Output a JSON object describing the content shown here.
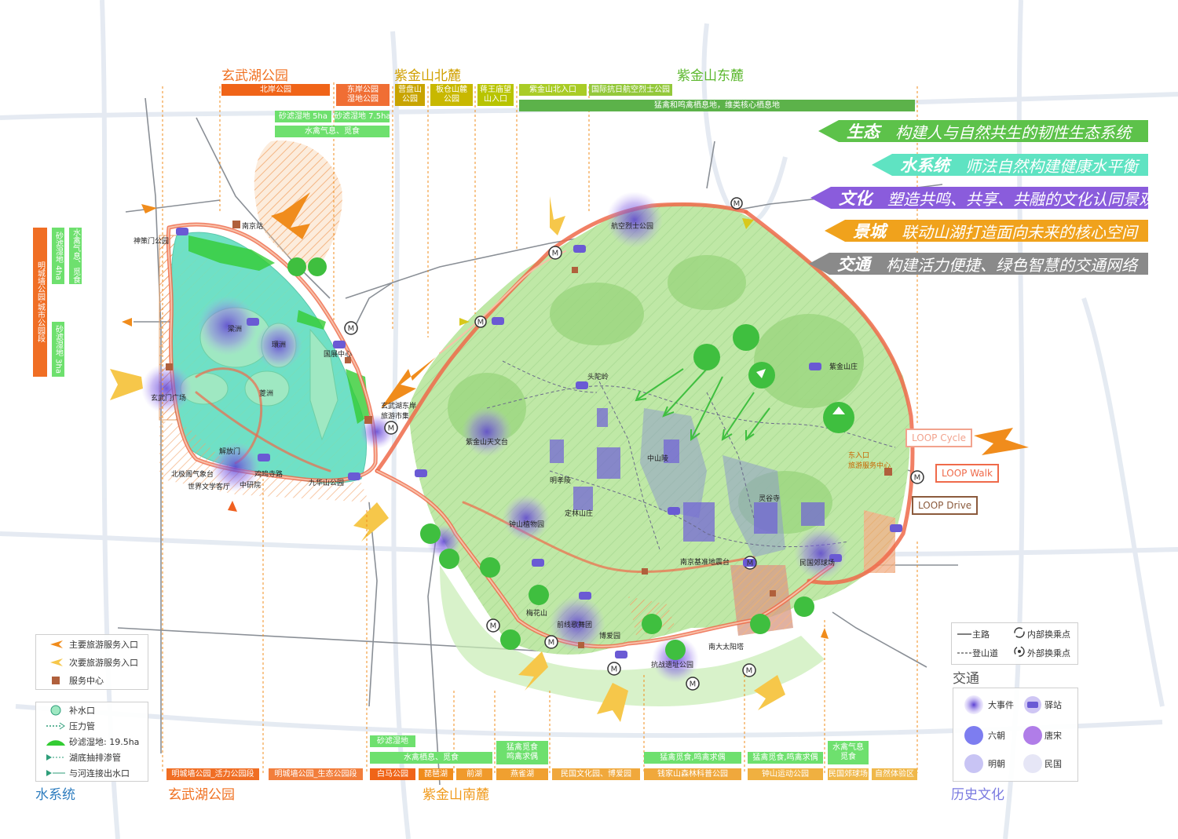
{
  "top_sections": {
    "xuanwu": "玄武湖公园",
    "zijin_north": "紫金山北麓",
    "zijin_east": "紫金山东麓",
    "bars": [
      "北岸公园",
      "东岸公园\n湿地公园",
      "营盘山\n公园",
      "板仓山麓\n公园",
      "蒋王庙望\n山入口",
      "紫金山北入口",
      "国际抗日航空烈士公园",
      "猛禽和鸣禽栖息地，维类核心栖息地"
    ],
    "sub_bars": [
      "砂滤湿地 5ha",
      "砂滤湿地 7.5ha",
      "水禽气息、觅食"
    ]
  },
  "goals": [
    {
      "key": "生态",
      "text": "构建人与自然共生的韧性生态系统",
      "color": "#5dc24a"
    },
    {
      "key": "水系统",
      "text": "师法自然构建健康水平衡",
      "color": "#5fe3c2"
    },
    {
      "key": "文化",
      "text": "塑造共鸣、共享、共融的文化认同景观",
      "color": "#8a5cdc"
    },
    {
      "key": "景城",
      "text": "联动山湖打造面向未来的核心空间",
      "color": "#f0a21c"
    },
    {
      "key": "交通",
      "text": "构建活力便捷、绿色智慧的交通网络",
      "color": "#8a8a8a"
    }
  ],
  "left_bars": [
    "明城墙公园·城市公园段",
    "砂滤湿地 4ha",
    "水禽气息、觅食",
    "砂滤湿地 3ha"
  ],
  "bottom_sections": {
    "xuanwu": "玄武湖公园",
    "zijin_south": "紫金山南麓",
    "bars": [
      "明城墙公园_活力公园段",
      "明城墙公园_生态公园段",
      "白马公园",
      "琵琶湖",
      "前湖",
      "燕雀湖",
      "民国文化园、博爱园",
      "钱家山森林科普公园",
      "钟山运动公园",
      "民国郊球场",
      "自然体验区"
    ],
    "upper_bars": [
      "砂滤湿地",
      "水禽栖息、觅食",
      "猛禽觅食\n鸣禽求偶",
      "猛禽觅食,鸣禽求偶",
      "猛禽觅食,鸣禽求偶",
      "水禽气息\n觅食"
    ]
  },
  "place_labels": {
    "nanjing_station": "南京站",
    "shence_gate": "神策门公园",
    "liangzhou": "梁洲",
    "huanzhou": "環洲",
    "yingzhou": "菱洲",
    "xuanwu_square": "玄武门广场",
    "jiefang_gate": "解放门",
    "jiming_temple": "鸡鸣寺路",
    "beiji_ge": "北极阁气象台",
    "world_lit": "世界文学客厅",
    "zhongyan": "中研院",
    "jiuhuashan": "九华山公园",
    "guoyu": "国展中心",
    "east_bank_market": "玄武湖东岸\n旅游市集",
    "hangkong": "航空烈士公园",
    "toutuo": "头陀岭",
    "observatory": "紫金山天文台",
    "mingxiao": "明孝陵",
    "zhongshan_mausoleum": "中山陵",
    "linggu": "灵谷寺",
    "dinglin": "定林山庄",
    "zhongshan_botanic": "钟山植物园",
    "meihua": "梅花山",
    "qianxian": "前线歌舞团",
    "bo_ai": "博爱园",
    "kangzhan": "抗战遗址公园",
    "nanjing_benchmark": "南京基准地震台",
    "taiyuan": "南大太阳塔",
    "minguo_golf": "民国郊球场",
    "zijin_villa": "紫金山庄",
    "east_entrance": "东入口\n旅游服务中心"
  },
  "loops": [
    {
      "label": "LOOP Cycle",
      "color": "#f2a38e"
    },
    {
      "label": "LOOP Walk",
      "color": "#ef6a4a"
    },
    {
      "label": "LOOP Drive",
      "color": "#8b5a3c"
    }
  ],
  "legend_left": {
    "items": [
      {
        "label": "主要旅游服务入口",
        "icon": "orange-arrow-icon",
        "color": "#f08c1c"
      },
      {
        "label": "次要旅游服务入口",
        "icon": "yellow-arrow-icon",
        "color": "#f6c74a"
      },
      {
        "label": "服务中心",
        "icon": "brown-square-icon",
        "color": "#b0603c"
      }
    ],
    "water": [
      {
        "label": "补水口",
        "icon": "teal-circle-icon"
      },
      {
        "label": "压力管",
        "icon": "dashed-arrow-icon"
      },
      {
        "label": "砂滤湿地: 19.5ha",
        "icon": "green-mound-icon"
      },
      {
        "label": "湖底抽排渗管",
        "icon": "triangle-dashed-icon"
      },
      {
        "label": "与河连接出水口",
        "icon": "triangle-dashed-icon"
      }
    ],
    "title": "水系统"
  },
  "legend_traffic": {
    "main_road": "主路",
    "mountain_path": "登山道",
    "inner_transfer": "内部换乘点",
    "outer_transfer": "外部换乘点",
    "title": "交通"
  },
  "legend_history": {
    "items": [
      {
        "label": "大事件",
        "color": "#8f6fe8"
      },
      {
        "label": "驿站",
        "color": "#6a5ad4"
      },
      {
        "label": "六朝",
        "color": "#7d7df0"
      },
      {
        "label": "唐宋",
        "color": "#b07de8"
      },
      {
        "label": "明朝",
        "color": "#c8c4f4"
      },
      {
        "label": "民国",
        "color": "#e6e6f6"
      }
    ],
    "title": "历史文化"
  },
  "metro_symbol": "M"
}
